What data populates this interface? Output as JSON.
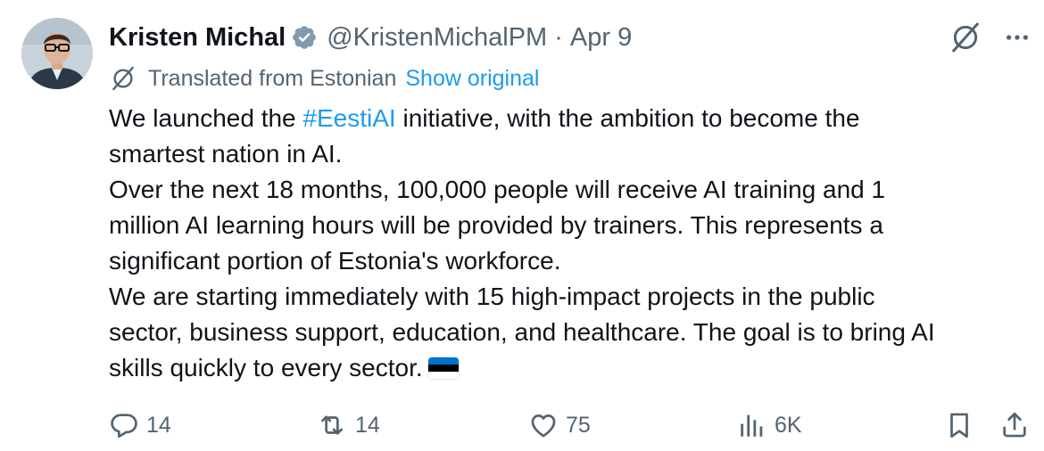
{
  "author": {
    "name": "Kristen Michal",
    "handle": "@KristenMichalPM",
    "separator": "·",
    "date": "Apr 9"
  },
  "translation": {
    "text": "Translated from Estonian",
    "show_original_label": "Show original"
  },
  "tweet": {
    "line1_before": "We launched the ",
    "hashtag": "#EestiAI",
    "line1_after": " initiative, with the ambition to become the",
    "line2": "smartest nation in AI.",
    "line3": "Over the next 18 months, 100,000 people will receive AI training and 1",
    "line4": "million AI learning hours will be provided by trainers. This represents a",
    "line5": "significant portion of Estonia's workforce.",
    "line6": "We are starting immediately with 15 high-impact projects in the public",
    "line7": "sector, business support, education, and healthcare. The goal is to bring AI",
    "line8": "skills quickly to every sector.",
    "flag": "Estonia flag emoji"
  },
  "actions": {
    "replies": "14",
    "reposts": "14",
    "likes": "75",
    "views": "6K"
  },
  "icons": [
    "verified-badge-icon",
    "grok-icon",
    "more-icon",
    "translate-icon",
    "reply-icon",
    "repost-icon",
    "like-icon",
    "views-icon",
    "bookmark-icon",
    "share-icon"
  ],
  "colors": {
    "text": "#0f1419",
    "secondary": "#536471",
    "link": "#1d9bf0",
    "flag_blue": "#0072ce",
    "flag_black": "#000000",
    "flag_white": "#ffffff"
  }
}
